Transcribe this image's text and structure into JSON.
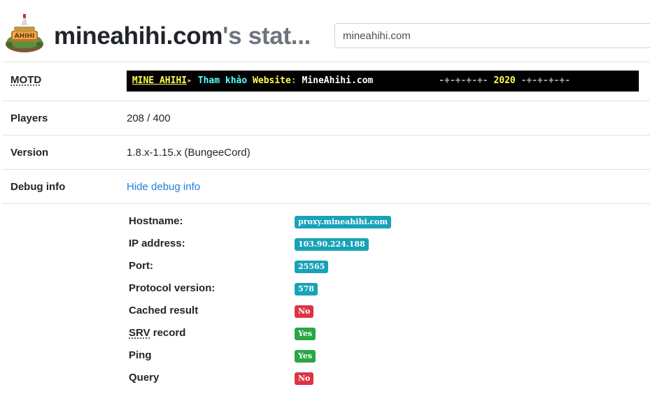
{
  "header": {
    "logo": "mineahihi-logo",
    "title_main": "mineahihi.com",
    "title_suffix": "'s stat...",
    "search_value": "mineahihi.com"
  },
  "motd": {
    "label": "MOTD",
    "segments": [
      {
        "text": "MINE AHIHI",
        "color": "#ffff55",
        "underline": true
      },
      {
        "text": "▸ ",
        "color": "#aaaaaa"
      },
      {
        "text": "Tham khảo ",
        "color": "#55ffff"
      },
      {
        "text": "Website",
        "color": "#ffff55"
      },
      {
        "text": ": ",
        "color": "#aaaaaa"
      },
      {
        "text": "MineAhihi.com",
        "color": "#ffffff"
      },
      {
        "text": "            -+-+-+-+- ",
        "color": "#aaaaaa"
      },
      {
        "text": "2020",
        "color": "#ffff55"
      },
      {
        "text": " -+-+-+-+-",
        "color": "#aaaaaa"
      }
    ]
  },
  "players": {
    "label": "Players",
    "value": "208 / 400"
  },
  "version": {
    "label": "Version",
    "value": "1.8.x-1.15.x (BungeeCord)"
  },
  "debug": {
    "label": "Debug info",
    "link": "Hide debug info"
  },
  "debug_items": [
    {
      "label": "Hostname:",
      "value": "proxy.mineahihi.com",
      "status": "info"
    },
    {
      "label": "IP address:",
      "value": "103.90.224.188",
      "status": "info"
    },
    {
      "label": "Port:",
      "value": "25565",
      "status": "info"
    },
    {
      "label": "Protocol version:",
      "value": "578",
      "status": "info"
    },
    {
      "label": "Cached result",
      "value": "No",
      "status": "danger"
    },
    {
      "label": "SRV record",
      "value": "Yes",
      "status": "success"
    },
    {
      "label": "Ping",
      "value": "Yes",
      "status": "success"
    },
    {
      "label": "Query",
      "value": "No",
      "status": "danger"
    }
  ],
  "colors": {
    "info": "#17a2b8",
    "danger": "#dc3545",
    "success": "#28a745",
    "link": "#1e7fd6"
  }
}
